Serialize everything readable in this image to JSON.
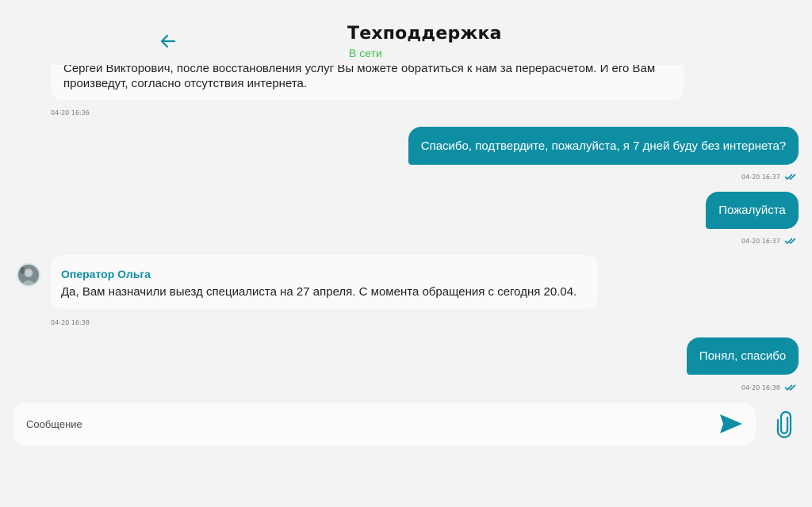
{
  "header": {
    "title": "Техподдержка",
    "status": "В сети",
    "back_icon": "arrow-left-icon"
  },
  "colors": {
    "accent": "#0e8ea3",
    "online": "#3bbf4a",
    "background": "#f3f3f3",
    "incoming_bubble": "#fafafa"
  },
  "messages": [
    {
      "direction": "incoming",
      "text_line1": "Сергей Викторович, после восстановления услуг Вы можете обратиться к нам за перерасчетом. И его Вам",
      "text_line2": "произведут, согласно отсутствия интернета.",
      "time": "04-20 16:36"
    },
    {
      "direction": "outgoing",
      "text": "Спасибо, подтвердите, пожалуйста, я 7 дней буду без интернета?",
      "time": "04-20 16:37",
      "read": true
    },
    {
      "direction": "outgoing",
      "text": "Пожалуйста",
      "time": "04-20 16:37",
      "read": true
    },
    {
      "direction": "incoming",
      "sender": "Оператор Ольга",
      "text": "Да, Вам назначили выезд специалиста на 27 апреля. С момента обращения с сегодня 20.04.",
      "time": "04-20 16:38"
    },
    {
      "direction": "outgoing",
      "text": "Понял, спасибо",
      "time": "04-20 16:38",
      "read": true
    }
  ],
  "composer": {
    "placeholder": "Сообщение",
    "value": "",
    "send_icon": "send-icon",
    "attach_icon": "paperclip-icon"
  }
}
